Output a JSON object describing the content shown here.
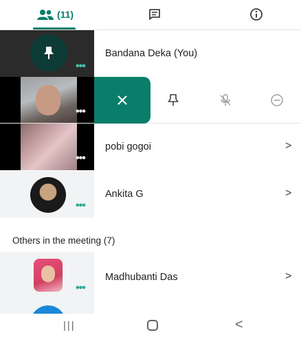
{
  "tabs": {
    "people_count": "(11)",
    "people_icon": "people-icon",
    "chat_icon": "chat-icon",
    "info_icon": "info-icon",
    "accent": "#0b7d6b"
  },
  "participants": [
    {
      "name": "Bandana Deka (You)",
      "tile": "pinned-avatar",
      "more": "•••"
    },
    {
      "name": "",
      "tile": "video",
      "more": "•••",
      "actions": [
        "close-icon",
        "pin-icon",
        "mic-off-icon",
        "remove-icon"
      ]
    },
    {
      "name": "pobi gogoi",
      "tile": "video",
      "more": "•••",
      "chevron": ">"
    },
    {
      "name": "Ankita G",
      "tile": "photo",
      "more": "•••",
      "chevron": ">"
    }
  ],
  "others": {
    "label": "Others in the meeting (7)",
    "items": [
      {
        "name": "Madhubanti Das",
        "more": "•••",
        "chevron": ">"
      }
    ]
  },
  "navbar": {
    "recent": "|||",
    "back": "<"
  }
}
